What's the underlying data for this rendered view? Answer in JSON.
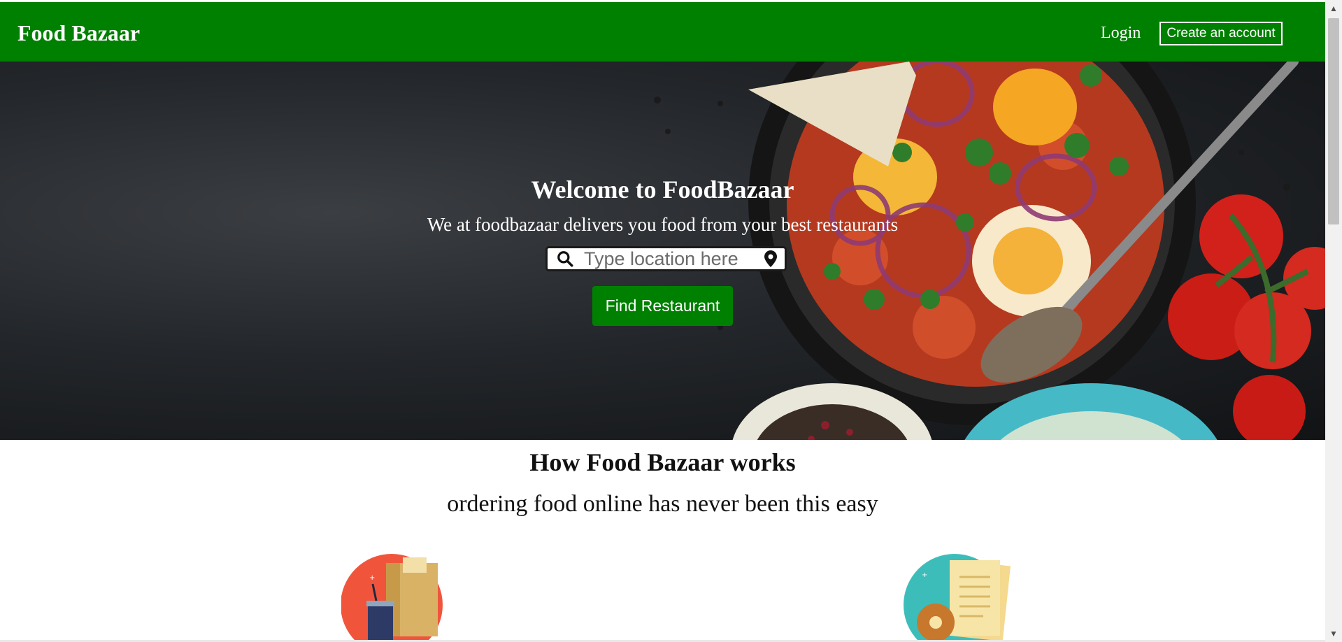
{
  "navbar": {
    "brand": "Food Bazaar",
    "login_label": "Login",
    "create_account_label": "Create an account"
  },
  "hero": {
    "title": "Welcome to FoodBazaar",
    "subtitle": "We at foodbazaar delivers you food from your best restaurants",
    "search_placeholder": "Type location here",
    "search_value": "",
    "find_button_label": "Find Restaurant",
    "icons": [
      "search-icon",
      "location-pin-icon"
    ]
  },
  "how_it_works": {
    "title": "How Food Bazaar works",
    "subtitle": "ordering food online has never been this easy"
  },
  "colors": {
    "brand_green": "#008000",
    "white": "#ffffff"
  }
}
